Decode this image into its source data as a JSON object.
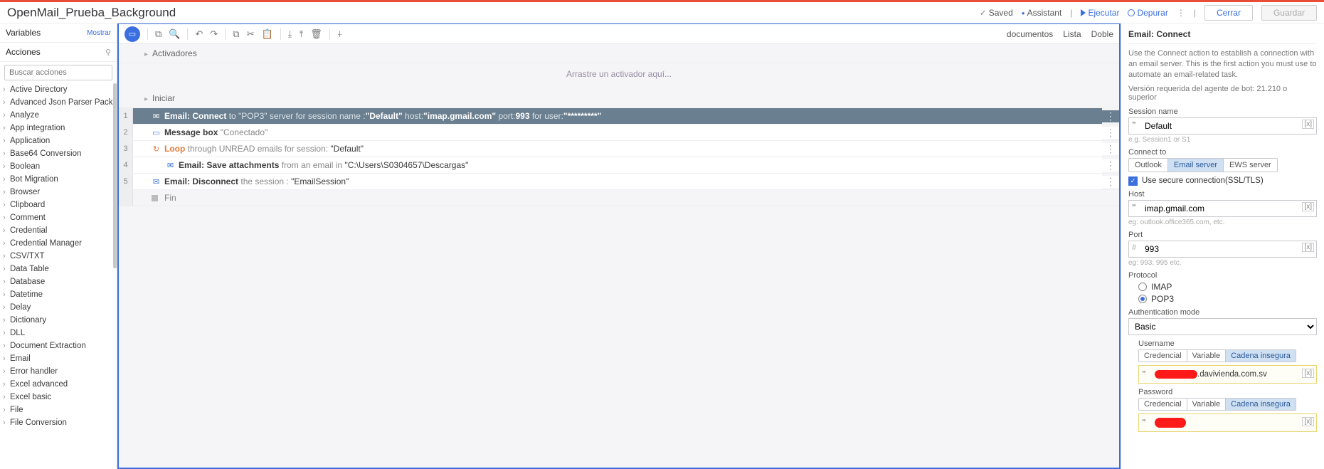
{
  "header": {
    "title": "OpenMail_Prueba_Background",
    "saved": "Saved",
    "assistant": "Assistant",
    "run": "Ejecutar",
    "debug": "Depurar",
    "close": "Cerrar",
    "save": "Guardar"
  },
  "left": {
    "variables": "Variables",
    "mostrar": "Mostrar",
    "acciones": "Acciones",
    "search_placeholder": "Buscar acciones",
    "items": [
      "Active Directory",
      "Advanced Json Parser Package",
      "Analyze",
      "App integration",
      "Application",
      "Base64 Conversion",
      "Boolean",
      "Bot Migration",
      "Browser",
      "Clipboard",
      "Comment",
      "Credential",
      "Credential Manager",
      "CSV/TXT",
      "Data Table",
      "Database",
      "Datetime",
      "Delay",
      "Dictionary",
      "DLL",
      "Document Extraction",
      "Email",
      "Error handler",
      "Excel advanced",
      "Excel basic",
      "File",
      "File Conversion"
    ]
  },
  "toolbar_right": {
    "docs": "documentos",
    "list": "Lista",
    "double": "Doble"
  },
  "flow": {
    "activadores": "Activadores",
    "dropzone": "Arrastre un activador aquí...",
    "iniciar": "Iniciar",
    "fin": "Fin",
    "steps": [
      {
        "n": "1",
        "a": "Email: Connect",
        "b": " to \"POP3\" server for session name :",
        "c": "\"Default\"",
        "d": " host:",
        "e": "\"imap.gmail.com\"",
        "f": " port:",
        "g": "993",
        "h": " for user:",
        "i": "\"*********\""
      },
      {
        "n": "2",
        "a": "Message box",
        "b": " \"Conectado\""
      },
      {
        "n": "3",
        "a": "Loop",
        "b": " through UNREAD emails for session: ",
        "c": "\"Default\""
      },
      {
        "n": "4",
        "a": "Email: Save attachments",
        "b": " from an email in ",
        "c": "\"C:\\Users\\S0304657\\Descargas\""
      },
      {
        "n": "5",
        "a": "Email: Disconnect",
        "b": " the session : ",
        "c": "\"EmailSession\""
      }
    ]
  },
  "right": {
    "title": "Email: Connect",
    "desc": "Use the Connect action to establish a connection with an email server. This is the first action you must use to automate an email-related task.",
    "version": "Versión requerida del agente de bot: 21.210 o superior",
    "session_lbl": "Session name",
    "session_val": "Default",
    "session_hint": "e.g. Session1 or S1",
    "connect_lbl": "Connect to",
    "connect_tabs": [
      "Outlook",
      "Email server",
      "EWS server"
    ],
    "secure": "Use secure connection(SSL/TLS)",
    "host_lbl": "Host",
    "host_val": "imap.gmail.com",
    "host_hint": "eg: outlook.office365.com, etc.",
    "port_lbl": "Port",
    "port_val": "993",
    "port_hint": "eg: 993, 995 etc.",
    "proto_lbl": "Protocol",
    "proto_imap": "IMAP",
    "proto_pop": "POP3",
    "auth_lbl": "Authentication mode",
    "auth_val": "Basic",
    "user_lbl": "Username",
    "cred_tabs": [
      "Credencial",
      "Variable",
      "Cadena insegura"
    ],
    "user_suffix": ".davivienda.com.sv",
    "pass_lbl": "Password",
    "var_token": "[x]"
  }
}
